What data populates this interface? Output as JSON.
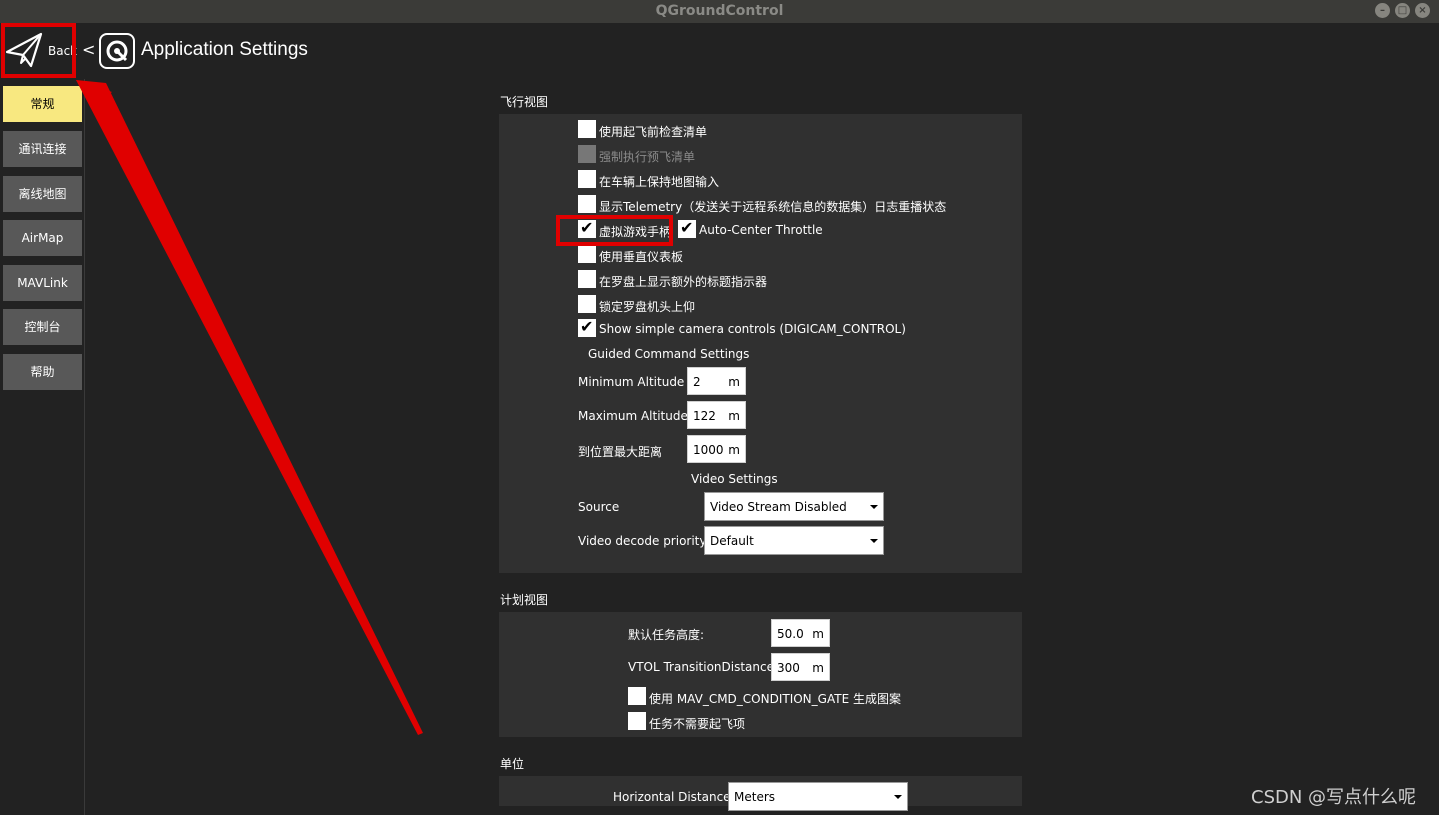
{
  "window": {
    "title": "QGroundControl"
  },
  "header": {
    "back_label": "Back",
    "separator": "<",
    "page_title": "Application Settings"
  },
  "sidebar": {
    "items": [
      {
        "label": "常规",
        "active": true
      },
      {
        "label": "通讯连接",
        "active": false
      },
      {
        "label": "离线地图",
        "active": false
      },
      {
        "label": "AirMap",
        "active": false
      },
      {
        "label": "MAVLink",
        "active": false
      },
      {
        "label": "控制台",
        "active": false
      },
      {
        "label": "帮助",
        "active": false
      }
    ]
  },
  "fly_view": {
    "title": "飞行视图",
    "checkboxes": [
      {
        "label": "使用起飞前检查清单",
        "checked": false,
        "enabled": true
      },
      {
        "label": "强制执行预飞清单",
        "checked": false,
        "enabled": false
      },
      {
        "label": "在车辆上保持地图输入",
        "checked": false,
        "enabled": true
      },
      {
        "label": "显示Telemetry（发送关于远程系统信息的数据集）日志重播状态",
        "checked": false,
        "enabled": true
      },
      {
        "label": "虚拟游戏手柄",
        "checked": true,
        "enabled": true
      },
      {
        "label": "使用垂直仪表板",
        "checked": false,
        "enabled": true
      },
      {
        "label": "在罗盘上显示额外的标题指示器",
        "checked": false,
        "enabled": true
      },
      {
        "label": "锁定罗盘机头上仰",
        "checked": false,
        "enabled": true
      },
      {
        "label": "Show simple camera controls (DIGICAM_CONTROL)",
        "checked": true,
        "enabled": true
      }
    ],
    "auto_center": {
      "label": "Auto-Center Throttle",
      "checked": true
    },
    "guided_title": "Guided Command Settings",
    "fields": [
      {
        "label": "Minimum Altitude",
        "value": "2",
        "unit": "m"
      },
      {
        "label": "Maximum Altitude",
        "value": "122",
        "unit": "m"
      },
      {
        "label": "到位置最大距离",
        "value": "1000",
        "unit": "m"
      }
    ],
    "video_title": "Video Settings",
    "video": {
      "source_label": "Source",
      "source_value": "Video Stream Disabled",
      "priority_label": "Video decode priority",
      "priority_value": "Default"
    }
  },
  "plan_view": {
    "title": "计划视图",
    "fields": [
      {
        "label": "默认任务高度:",
        "value": "50.0",
        "unit": "m"
      },
      {
        "label": "VTOL TransitionDistance",
        "value": "300",
        "unit": "m"
      }
    ],
    "checkboxes": [
      {
        "label": "使用 MAV_CMD_CONDITION_GATE 生成图案",
        "checked": false
      },
      {
        "label": "任务不需要起飞项",
        "checked": false
      }
    ]
  },
  "units": {
    "title": "单位",
    "horizontal_label": "Horizontal Distance",
    "horizontal_value": "Meters"
  },
  "annotation": {
    "color": "#e00000"
  },
  "watermark": "CSDN @写点什么呢"
}
